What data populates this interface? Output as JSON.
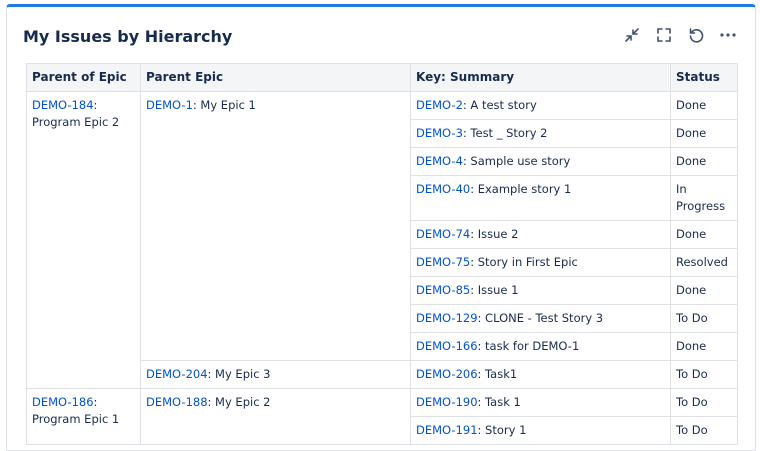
{
  "gadget": {
    "title": "My Issues by Hierarchy"
  },
  "columns": [
    "Parent of Epic",
    "Parent Epic",
    "Key: Summary",
    "Status"
  ],
  "rows": [
    {
      "parent_key": "DEMO-184",
      "parent_sep": ":",
      "parent_name": "Program Epic 2",
      "epic_key": "DEMO-1",
      "epic_name": ": My Epic 1",
      "key": "DEMO-2",
      "summary": ": A test story",
      "status": "Done"
    },
    {
      "key": "DEMO-3",
      "summary": ": Test _ Story 2",
      "status": "Done"
    },
    {
      "key": "DEMO-4",
      "summary": ": Sample use story",
      "status": "Done"
    },
    {
      "key": "DEMO-40",
      "summary": ": Example story 1",
      "status": "In Progress"
    },
    {
      "key": "DEMO-74",
      "summary": ": Issue 2",
      "status": "Done"
    },
    {
      "key": "DEMO-75",
      "summary": ": Story in First Epic",
      "status": "Resolved"
    },
    {
      "key": "DEMO-85",
      "summary": ": Issue 1",
      "status": "Done"
    },
    {
      "key": "DEMO-129",
      "summary": ": CLONE - Test Story 3",
      "status": "To Do"
    },
    {
      "key": "DEMO-166",
      "summary": ": task for DEMO-1",
      "status": "Done"
    },
    {
      "epic_key": "DEMO-204",
      "epic_name": ": My Epic 3",
      "key": "DEMO-206",
      "summary": ": Task1",
      "status": "To Do"
    },
    {
      "parent_key": "DEMO-186",
      "parent_sep": ":",
      "parent_name": "Program Epic 1",
      "epic_key": "DEMO-188",
      "epic_name": ": My Epic 2",
      "key": "DEMO-190",
      "summary": ": Task 1",
      "status": "To Do"
    },
    {
      "key": "DEMO-191",
      "summary": ": Story 1",
      "status": "To Do"
    }
  ],
  "icons": [
    "collapse-icon",
    "fullscreen-icon",
    "refresh-icon",
    "more-icon"
  ]
}
